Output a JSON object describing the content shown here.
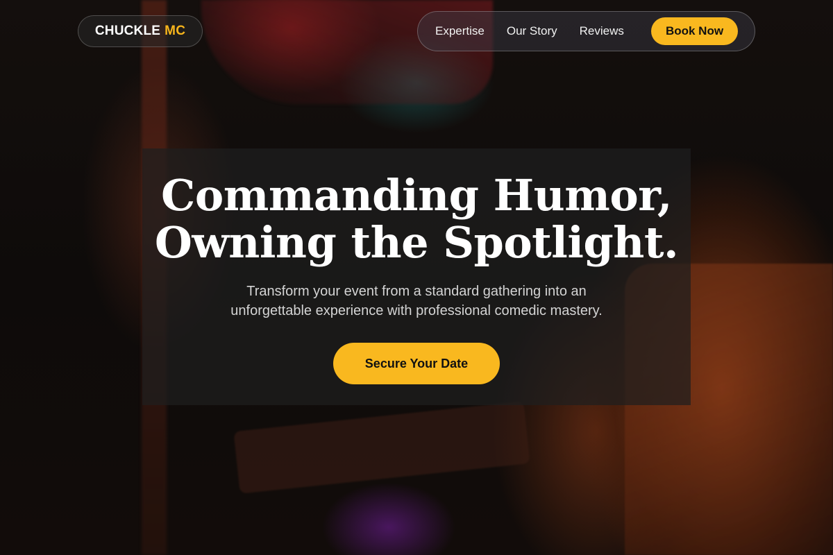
{
  "header": {
    "logo_main": "CHUCKLE",
    "logo_accent": "MC",
    "nav": {
      "items": [
        {
          "label": "Expertise"
        },
        {
          "label": "Our Story"
        },
        {
          "label": "Reviews"
        }
      ],
      "book_label": "Book Now"
    }
  },
  "hero": {
    "headline_line1": "Commanding Humor,",
    "headline_line2": "Owning the Spotlight.",
    "subtitle_line1": "Transform your event from a standard gathering into an",
    "subtitle_line2": "unforgettable experience with professional comedic mastery.",
    "cta_label": "Secure Your Date"
  },
  "colors": {
    "accent": "#f9b81f",
    "panel": "#1e1e1e",
    "text": "#ffffff"
  }
}
